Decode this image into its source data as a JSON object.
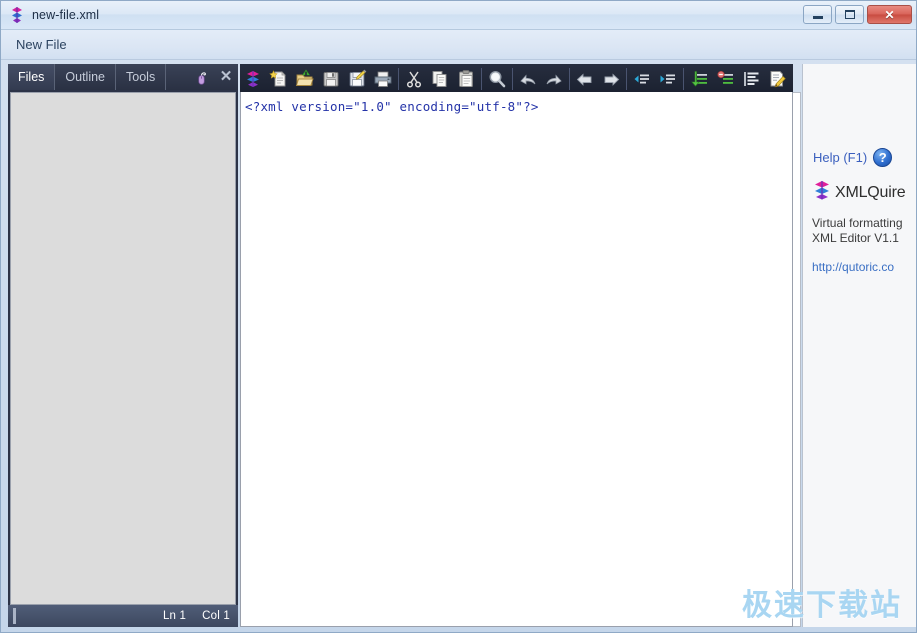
{
  "window": {
    "title": "new-file.xml",
    "app_icon": "xmlquire-logo-icon",
    "buttons": {
      "minimize": "minimize-icon",
      "maximize": "maximize-icon",
      "close": "✕"
    }
  },
  "menubar": {
    "items": [
      {
        "label": "New File"
      }
    ]
  },
  "left_panel": {
    "tabs": [
      {
        "label": "Files",
        "active": true
      },
      {
        "label": "Outline",
        "active": false
      },
      {
        "label": "Tools",
        "active": false
      }
    ],
    "tools": {
      "mouse_icon": "mouse-icon",
      "close_label": "✕"
    },
    "statusbar": {
      "line": "Ln 1",
      "column": "Col 1"
    }
  },
  "toolbar": {
    "groups": [
      {
        "buttons": [
          {
            "name": "xmlquire-logo-button",
            "icon": "xmlquire-logo-icon",
            "label": "XMLQuire"
          },
          {
            "name": "new-file-button",
            "icon": "new-document-icon",
            "label": "New"
          },
          {
            "name": "open-file-button",
            "icon": "open-folder-icon",
            "label": "Open"
          },
          {
            "name": "save-button",
            "icon": "floppy-disk-icon",
            "label": "Save"
          },
          {
            "name": "save-as-button",
            "icon": "floppy-disk-pencil-icon",
            "label": "Save As"
          },
          {
            "name": "print-button",
            "icon": "printer-icon",
            "label": "Print"
          }
        ]
      },
      {
        "buttons": [
          {
            "name": "cut-button",
            "icon": "scissors-icon",
            "label": "Cut"
          },
          {
            "name": "copy-button",
            "icon": "copy-pages-icon",
            "label": "Copy"
          },
          {
            "name": "paste-button",
            "icon": "clipboard-icon",
            "label": "Paste"
          }
        ]
      },
      {
        "buttons": [
          {
            "name": "find-button",
            "icon": "magnifier-icon",
            "label": "Find"
          }
        ]
      },
      {
        "buttons": [
          {
            "name": "undo-button",
            "icon": "undo-arrow-icon",
            "label": "Undo"
          },
          {
            "name": "redo-button",
            "icon": "redo-arrow-icon",
            "label": "Redo"
          }
        ]
      },
      {
        "buttons": [
          {
            "name": "back-button",
            "icon": "arrow-left-icon",
            "label": "Back"
          },
          {
            "name": "forward-button",
            "icon": "arrow-right-icon",
            "label": "Forward"
          }
        ]
      },
      {
        "buttons": [
          {
            "name": "outdent-button",
            "icon": "outdent-icon",
            "label": "Outdent"
          },
          {
            "name": "indent-button",
            "icon": "indent-icon",
            "label": "Indent"
          }
        ]
      },
      {
        "buttons": [
          {
            "name": "expand-all-button",
            "icon": "expand-green-icon",
            "label": "Expand"
          },
          {
            "name": "collapse-all-button",
            "icon": "collapse-red-icon",
            "label": "Collapse"
          },
          {
            "name": "format-lines-button",
            "icon": "line-list-icon",
            "label": "Format"
          },
          {
            "name": "edit-markup-button",
            "icon": "pencil-page-icon",
            "label": "Edit"
          }
        ]
      }
    ]
  },
  "editor": {
    "content": "<?xml version=\"1.0\" encoding=\"utf-8\"?>",
    "syntax_color": "#2433a8"
  },
  "help_panel": {
    "help_label": "Help (F1)",
    "help_badge": "?",
    "brand": "XMLQuire",
    "description_line1": "Virtual formatting",
    "description_line2": "XML Editor V1.1",
    "url": "http://qutoric.co"
  },
  "watermark": {
    "text": "极速下载站"
  },
  "colors": {
    "titlebar_top": "#e9f1fa",
    "toolbar_bg": "#1b2130",
    "tabstrip_bg": "#2c3347",
    "panel_body": "#dcdcdc",
    "editor_bg": "#ffffff",
    "xml_text": "#2433a8",
    "link": "#3a5fbe",
    "close_button": "#c84b40",
    "watermark": "#a9d6f2"
  }
}
